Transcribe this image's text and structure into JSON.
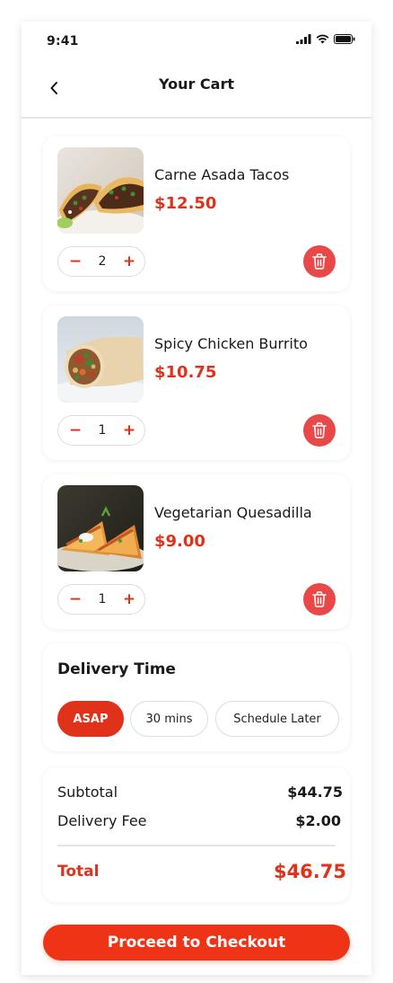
{
  "status_bar": {
    "time": "9:41"
  },
  "header": {
    "title": "Your Cart"
  },
  "cart_items": [
    {
      "name": "Carne Asada Tacos",
      "price": "$12.50",
      "quantity": "2"
    },
    {
      "name": "Spicy Chicken Burrito",
      "price": "$10.75",
      "quantity": "1"
    },
    {
      "name": "Vegetarian Quesadilla",
      "price": "$9.00",
      "quantity": "1"
    }
  ],
  "stepper": {
    "minus": "−",
    "plus": "+"
  },
  "delivery": {
    "title": "Delivery Time",
    "options": [
      "ASAP",
      "30 mins",
      "Schedule Later"
    ],
    "selected": "ASAP"
  },
  "summary": {
    "subtotal_label": "Subtotal",
    "subtotal_value": "$44.75",
    "fee_label": "Delivery Fee",
    "fee_value": "$2.00",
    "total_label": "Total",
    "total_value": "$46.75"
  },
  "checkout": {
    "label": "Proceed to Checkout"
  },
  "colors": {
    "accent": "#e0321a",
    "delete": "#e84848",
    "button": "#ef3317"
  },
  "icons": {
    "back": "chevron-left-icon",
    "delete": "trash-icon",
    "signal": "cellular-signal-icon",
    "wifi": "wifi-icon",
    "battery": "battery-icon"
  }
}
